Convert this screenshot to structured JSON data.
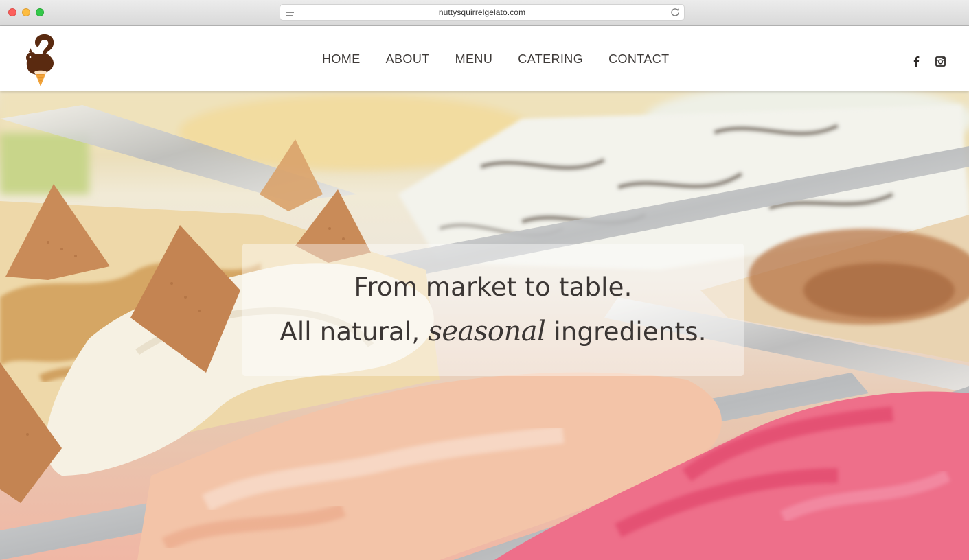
{
  "browser": {
    "url": "nuttysquirrelgelato.com"
  },
  "site": {
    "logo_icon": "squirrel-cone-logo",
    "brand_color": "#5a2a10",
    "accent_color": "#f1a33a",
    "nav": [
      {
        "label": "HOME"
      },
      {
        "label": "ABOUT"
      },
      {
        "label": "MENU"
      },
      {
        "label": "CATERING"
      },
      {
        "label": "CONTACT"
      }
    ],
    "social": [
      {
        "icon": "facebook-icon"
      },
      {
        "icon": "instagram-icon"
      }
    ]
  },
  "hero": {
    "line1": "From market to table.",
    "line2_before": "All natural,",
    "line2_script": "seasonal",
    "line2_after": "ingredients."
  }
}
